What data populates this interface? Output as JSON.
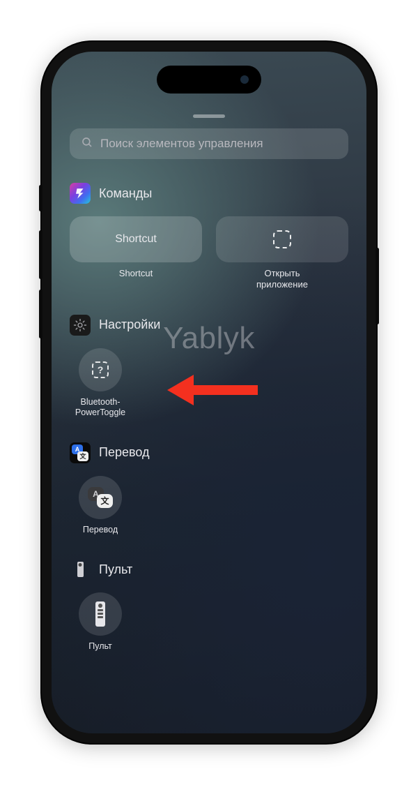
{
  "watermark": "Yablyk",
  "grabber_label": "drag-handle",
  "search": {
    "placeholder": "Поиск элементов управления"
  },
  "sections": {
    "shortcuts": {
      "title": "Команды",
      "items": [
        {
          "tile_text": "Shortcut",
          "label": "Shortcut"
        },
        {
          "label": "Открыть\nприложение"
        }
      ]
    },
    "settings": {
      "title": "Настройки",
      "items": [
        {
          "label": "Bluetooth-\nPowerToggle"
        }
      ]
    },
    "translate": {
      "title": "Перевод",
      "items": [
        {
          "label": "Перевод"
        }
      ]
    },
    "remote": {
      "title": "Пульт",
      "items": [
        {
          "label": "Пульт"
        }
      ]
    }
  },
  "annotation": {
    "arrow_color": "#f4301f"
  }
}
